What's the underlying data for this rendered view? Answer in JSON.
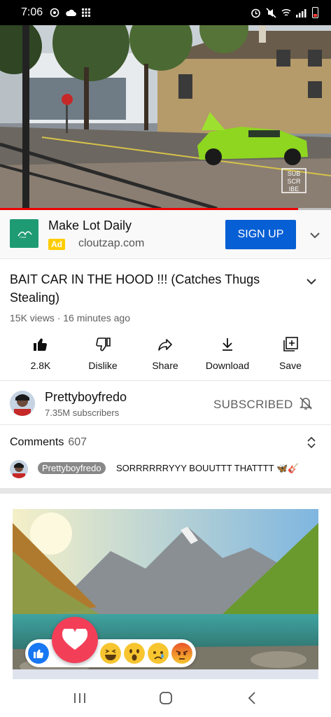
{
  "status_bar": {
    "time": "7:06",
    "left_icons": [
      "sync-icon",
      "cloud-icon",
      "grid-icon"
    ],
    "right_icons": [
      "alarm-icon",
      "mute-icon",
      "wifi-icon",
      "signal-icon",
      "battery-low-icon"
    ]
  },
  "video": {
    "watermark": [
      "SUB",
      "SCR",
      "IBE"
    ],
    "progress": 0.9,
    "colors": {
      "car": "#8ed620",
      "progress": "#ee0000"
    }
  },
  "ad": {
    "title": "Make Lot Daily",
    "badge": "Ad",
    "domain": "cloutzap.com",
    "cta_label": "SIGN UP",
    "colors": {
      "cta": "#065fd4",
      "badge": "#ffcc00",
      "logo": "#1f9b73"
    }
  },
  "video_info": {
    "title": "BAIT CAR IN THE HOOD !!! (Catches Thugs Stealing)",
    "meta": "15K views · 16 minutes ago"
  },
  "actions": [
    {
      "label": "2.8K",
      "icon": "thumbs-up-icon"
    },
    {
      "label": "Dislike",
      "icon": "thumbs-down-icon"
    },
    {
      "label": "Share",
      "icon": "share-icon"
    },
    {
      "label": "Download",
      "icon": "download-icon"
    },
    {
      "label": "Save",
      "icon": "save-to-playlist-icon"
    }
  ],
  "channel": {
    "name": "Prettyboyfredo",
    "subscribers": "7.35M subscribers",
    "subscribe_state": "SUBSCRIBED"
  },
  "comments": {
    "label": "Comments",
    "count": "607",
    "top_comment": {
      "author": "Prettyboyfredo",
      "text": "SORRRRRRYYY BOUUTTT THATTTT 🦋🎸"
    }
  },
  "reactions": [
    "like-reaction-icon",
    "love-reaction-icon",
    "haha-reaction-icon",
    "wow-reaction-icon",
    "sad-reaction-icon",
    "angry-reaction-icon"
  ],
  "nav": [
    "recents-button",
    "home-button",
    "back-button"
  ]
}
